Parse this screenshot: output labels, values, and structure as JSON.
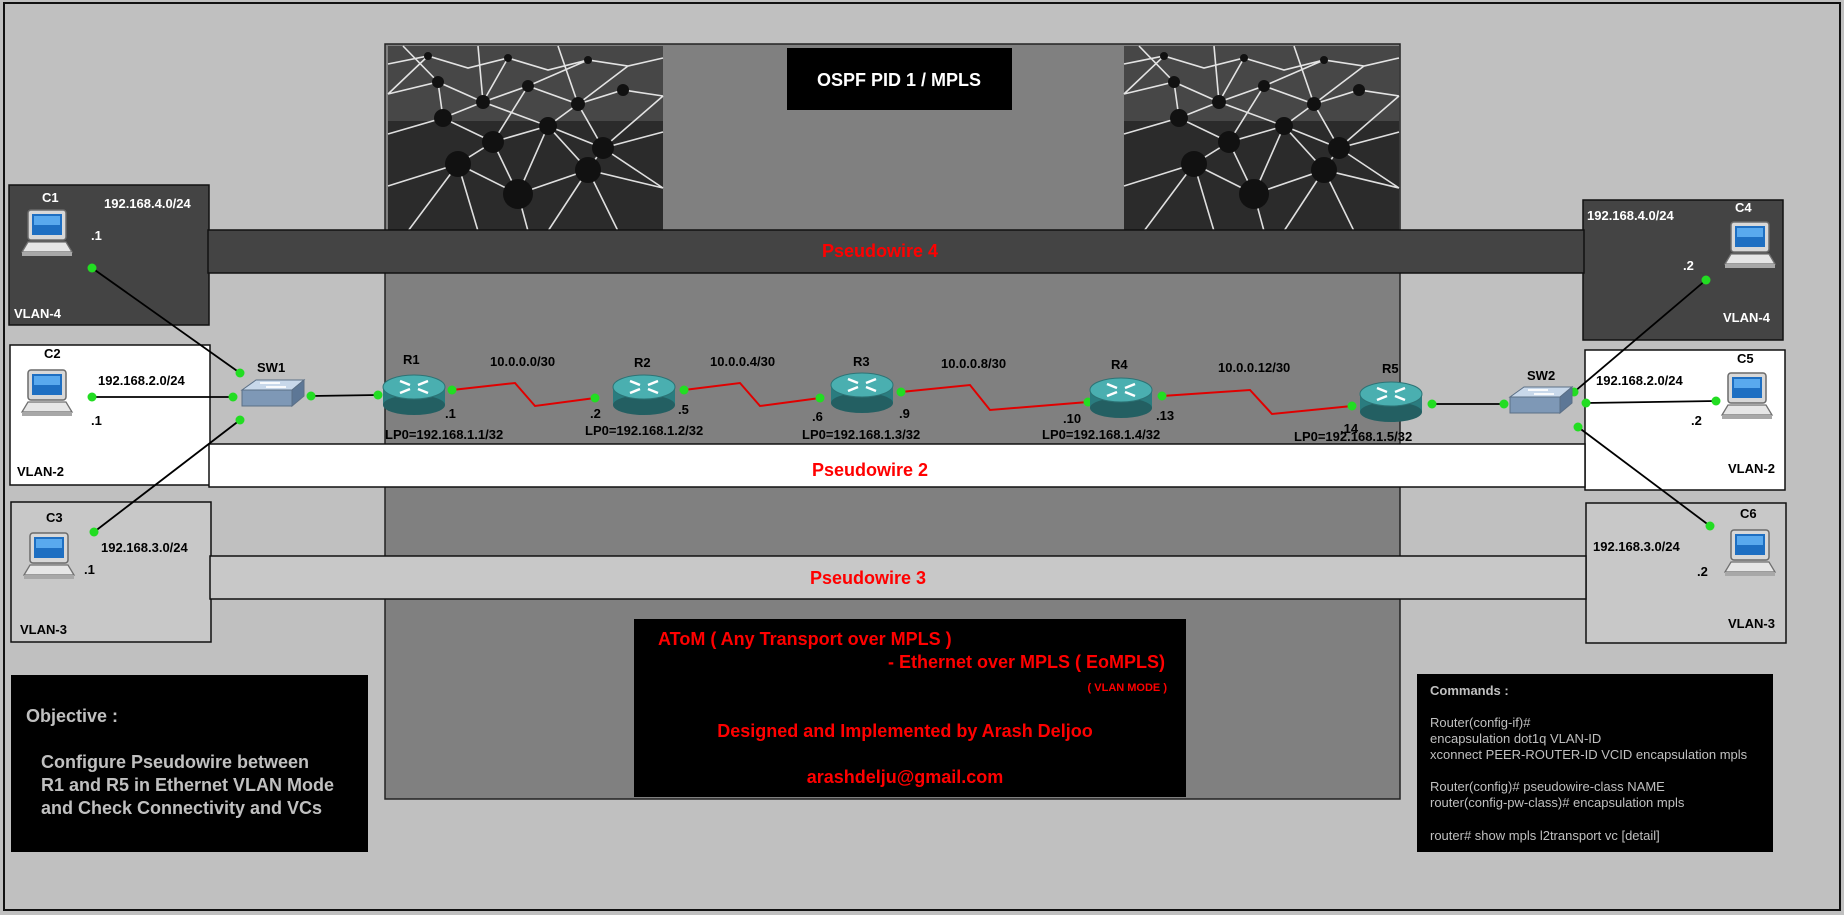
{
  "core": {
    "title": "OSPF PID 1 / MPLS"
  },
  "pseudowires": [
    {
      "label": "Pseudowire 4"
    },
    {
      "label": "Pseudowire 2"
    },
    {
      "label": "Pseudowire 3"
    }
  ],
  "routers": [
    {
      "name": "R1",
      "loopback": "LP0=192.168.1.1/32"
    },
    {
      "name": "R2",
      "loopback": "LP0=192.168.1.2/32"
    },
    {
      "name": "R3",
      "loopback": "LP0=192.168.1.3/32"
    },
    {
      "name": "R4",
      "loopback": "LP0=192.168.1.4/32"
    },
    {
      "name": "R5",
      "loopback": "LP0=192.168.1.5/32"
    }
  ],
  "links": [
    {
      "subnet": "10.0.0.0/30",
      "left_ip": ".1",
      "right_ip": ".2"
    },
    {
      "subnet": "10.0.0.4/30",
      "left_ip": ".5",
      "right_ip": ".6"
    },
    {
      "subnet": "10.0.0.8/30",
      "left_ip": ".9",
      "right_ip": ".10"
    },
    {
      "subnet": "10.0.0.12/30",
      "left_ip": ".13",
      "right_ip": ".14"
    }
  ],
  "switches": [
    {
      "name": "SW1"
    },
    {
      "name": "SW2"
    }
  ],
  "clients": [
    {
      "name": "C1",
      "subnet": "192.168.4.0/24",
      "ip": ".1",
      "vlan": "VLAN-4"
    },
    {
      "name": "C2",
      "subnet": "192.168.2.0/24",
      "ip": ".1",
      "vlan": "VLAN-2"
    },
    {
      "name": "C3",
      "subnet": "192.168.3.0/24",
      "ip": ".1",
      "vlan": "VLAN-3"
    },
    {
      "name": "C4",
      "subnet": "192.168.4.0/24",
      "ip": ".2",
      "vlan": "VLAN-4"
    },
    {
      "name": "C5",
      "subnet": "192.168.2.0/24",
      "ip": ".2",
      "vlan": "VLAN-2"
    },
    {
      "name": "C6",
      "subnet": "192.168.3.0/24",
      "ip": ".2",
      "vlan": "VLAN-3"
    }
  ],
  "info": {
    "line1": "AToM ( Any Transport over MPLS )",
    "line2": "- Ethernet over MPLS ( EoMPLS)",
    "line3": "( VLAN MODE )",
    "designer": "Designed and Implemented by Arash Deljoo",
    "email": "arashdelju@gmail.com"
  },
  "objective": {
    "heading": "Objective :",
    "lines": [
      "Configure Pseudowire between",
      "R1 and R5 in Ethernet VLAN Mode",
      "and Check Connectivity and VCs"
    ]
  },
  "commands": {
    "heading": "Commands :",
    "lines": [
      "Router(config-if)#",
      "encapsulation dot1q VLAN-ID",
      "xconnect PEER-ROUTER-ID VCID encapsulation mpls",
      "",
      "Router(config)# pseudowire-class NAME",
      "router(config-pw-class)# encapsulation mpls",
      "",
      "router# show mpls l2transport vc [detail]"
    ]
  },
  "colors": {
    "accent_red": "#ff0000",
    "link_red": "#e00000",
    "port_green": "#22dd22",
    "core_gray": "#808080",
    "router_teal": "#3f9ea0"
  }
}
